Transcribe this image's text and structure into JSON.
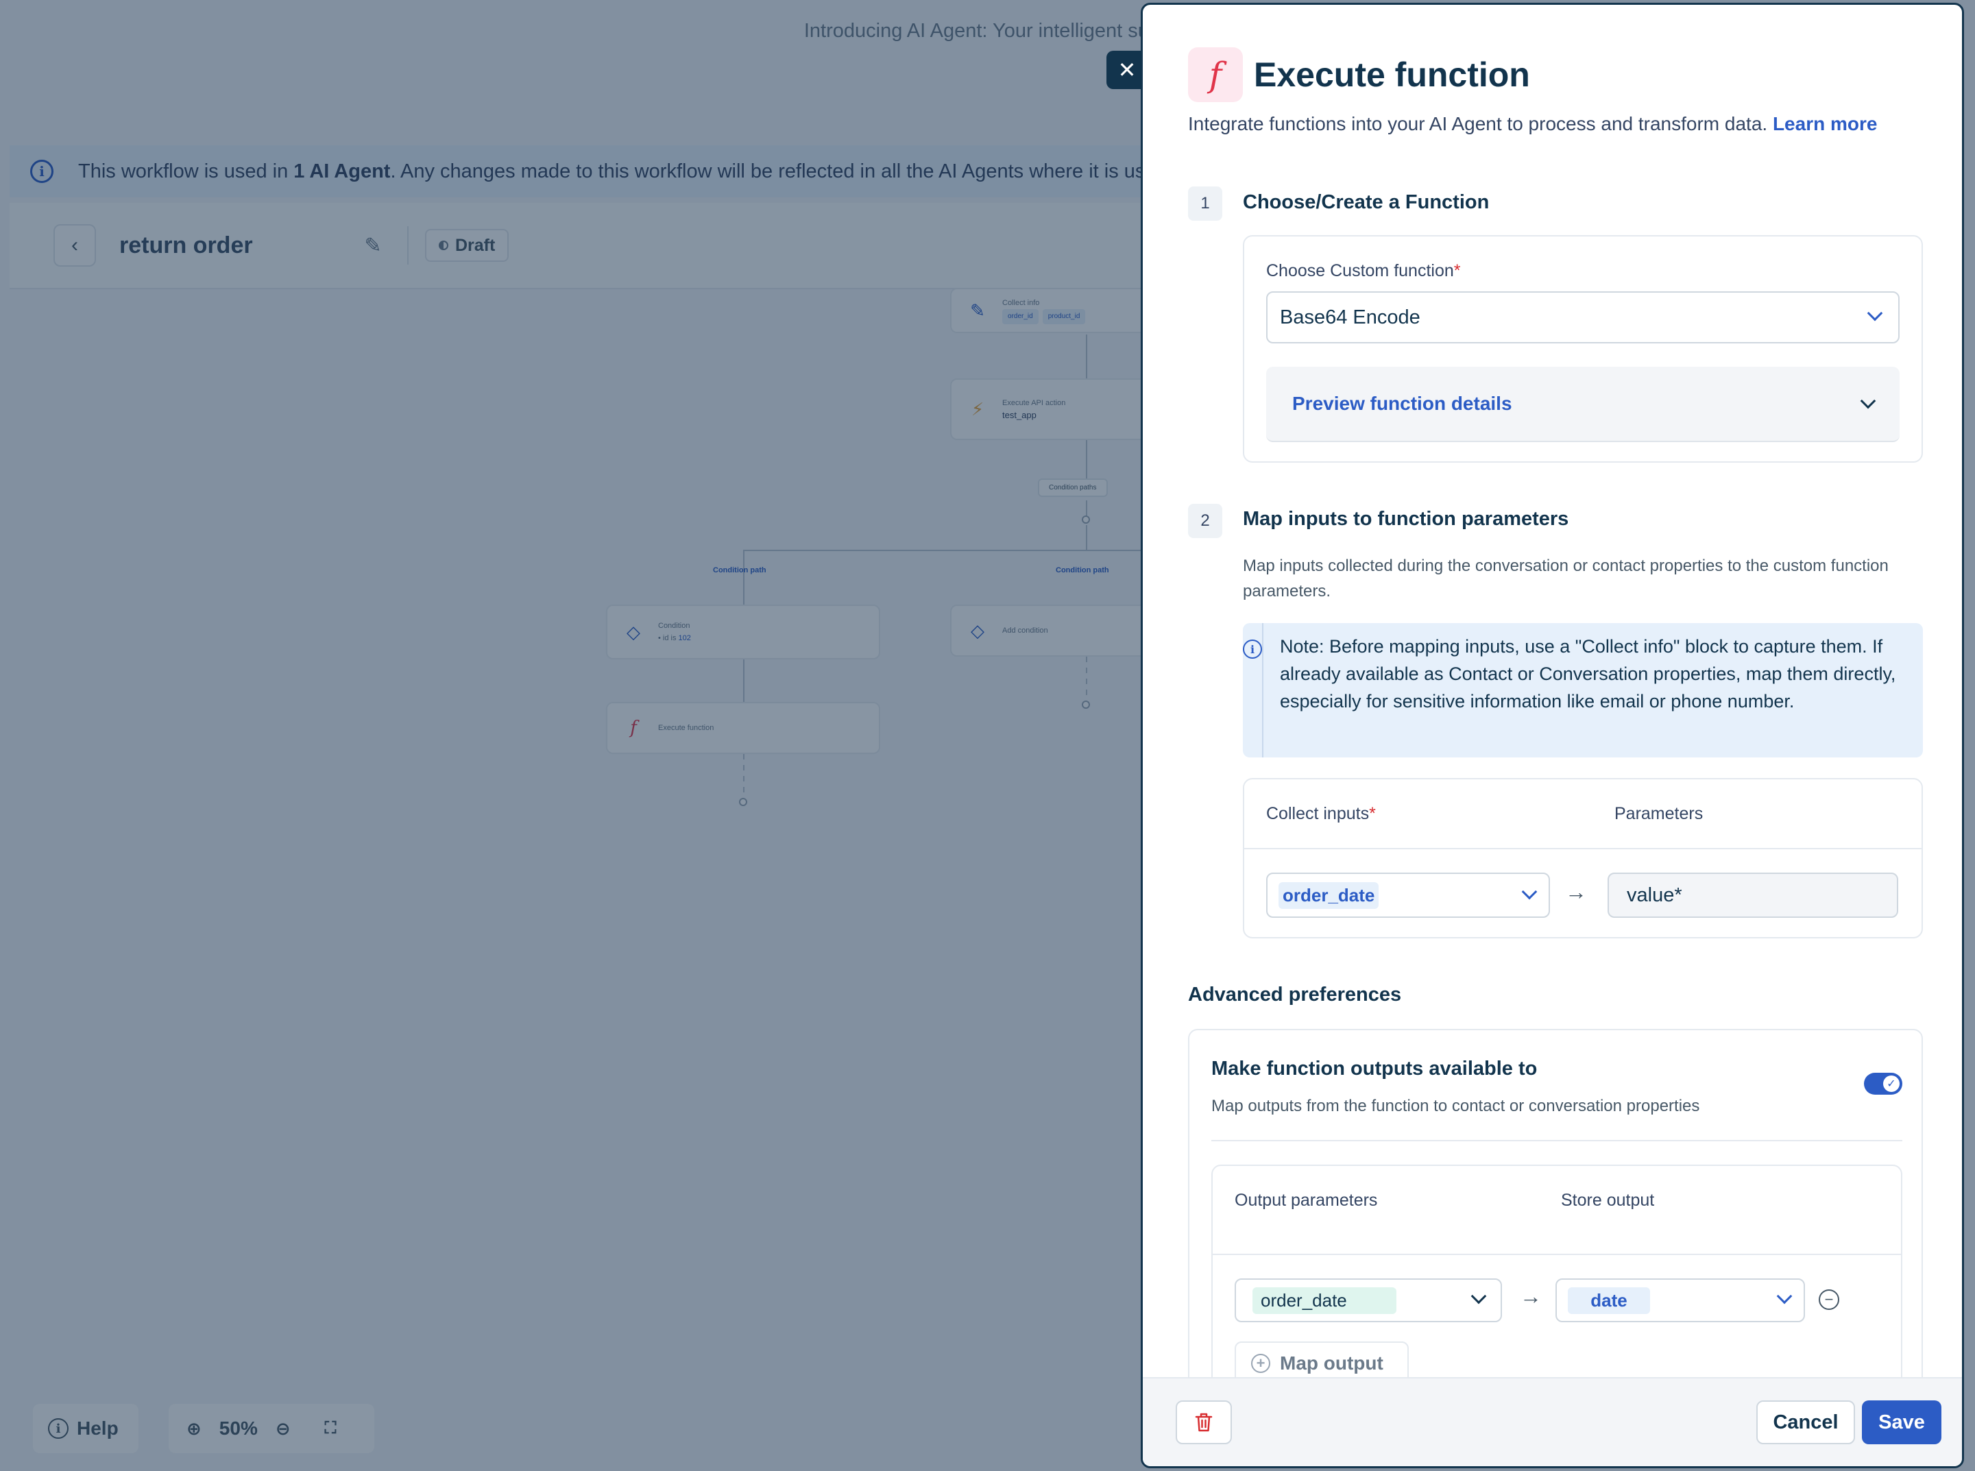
{
  "background": {
    "announcement": "Introducing AI Agent: Your intelligent supp",
    "info_bar": {
      "prefix": "This workflow is used in ",
      "bold": "1 AI Agent",
      "suffix": ". Any changes made to this workflow will be reflected in all the AI Agents where it is us"
    },
    "workflow_title": "return order",
    "status_badge": "Draft",
    "nodes": {
      "collect_info": {
        "title": "Collect info",
        "chips": [
          "order_id",
          "product_id"
        ]
      },
      "execute_api": {
        "title": "Execute API action",
        "value": "test_app"
      },
      "condition_paths": "Condition paths",
      "condition_path_left": "Condition path",
      "condition_path_right": "Condition path",
      "condition": {
        "title": "Condition",
        "rule_prefix": "• id is ",
        "rule_value": "102"
      },
      "add_condition": "Add condition",
      "execute_function": "Execute function"
    },
    "help_label": "Help",
    "zoom_level": "50%"
  },
  "drawer": {
    "title": "Execute function",
    "subtitle": "Integrate functions into your AI Agent to process and transform data.",
    "learn_more": "Learn more",
    "step1": {
      "number": "1",
      "title": "Choose/Create a Function",
      "field_label": "Choose Custom function",
      "required_mark": "*",
      "selected_value": "Base64 Encode",
      "preview_label": "Preview function details"
    },
    "step2": {
      "number": "2",
      "title": "Map inputs to function parameters",
      "description": "Map inputs collected during the conversation or contact properties to the custom function parameters.",
      "note": "Note: Before mapping inputs, use a \"Collect info\" block to capture them. If already available as Contact or Conversation properties, map them directly, especially for sensitive information like email or phone number.",
      "col_inputs": "Collect inputs",
      "required_mark": "*",
      "col_params": "Parameters",
      "input_value": "order_date",
      "param_value": "value*"
    },
    "advanced": {
      "title": "Advanced preferences",
      "outputs_title": "Make function outputs available to",
      "outputs_desc": "Map outputs from the function to contact or conversation properties",
      "toggle_on": true,
      "col_output": "Output parameters",
      "col_store": "Store output",
      "output_value": "order_date",
      "store_value": "date",
      "map_output_label": "Map output"
    },
    "footer": {
      "cancel": "Cancel",
      "save": "Save"
    }
  },
  "colors": {
    "primary": "#2c5cc5",
    "text": "#12344d",
    "danger": "#d72d30",
    "function_icon": "#e0354a"
  }
}
